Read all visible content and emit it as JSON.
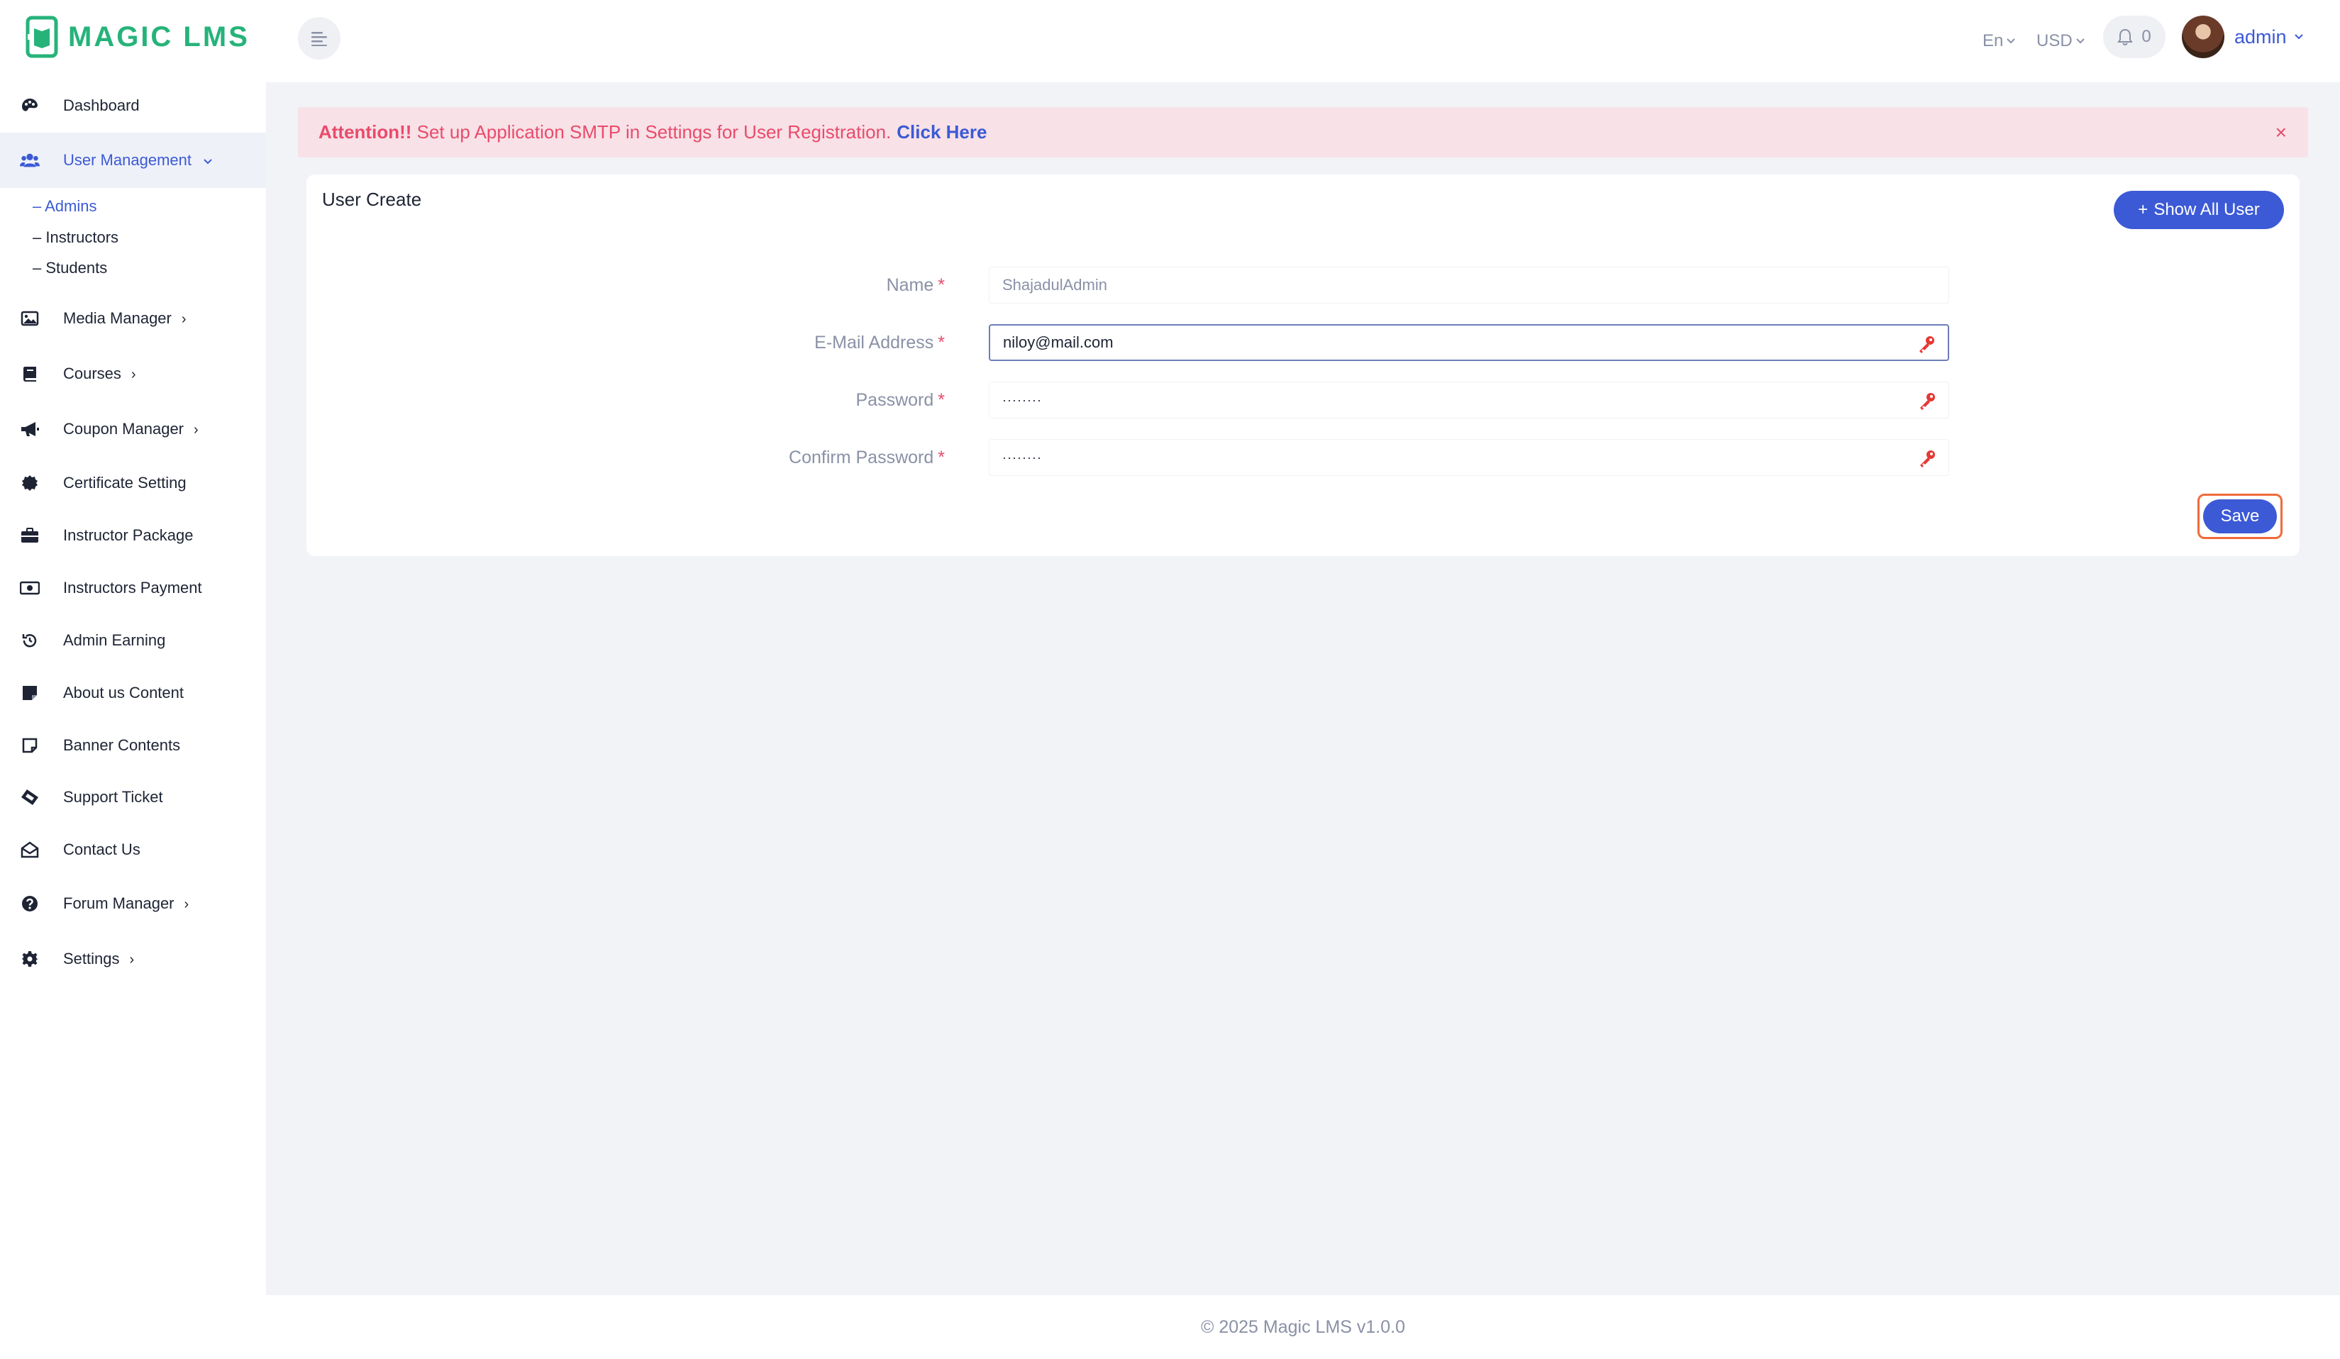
{
  "header": {
    "brand": "MAGIC LMS",
    "language": "En",
    "currency": "USD",
    "notification_count": "0",
    "user_name": "admin",
    "icons": {
      "logo": "book-logo-icon",
      "menu": "align-left-icon",
      "bell": "bell-icon",
      "chevron": "chevron-down-icon"
    }
  },
  "sidebar": {
    "items": [
      {
        "label": "Dashboard",
        "icon": "palette-icon"
      },
      {
        "label": "User Management",
        "icon": "users-icon",
        "arrow": "⌄"
      },
      {
        "label": "Media Manager",
        "icon": "image-icon",
        "arrow": "›"
      },
      {
        "label": "Courses",
        "icon": "book-icon",
        "arrow": "›"
      },
      {
        "label": "Coupon Manager",
        "icon": "megaphone-icon",
        "arrow": "›"
      },
      {
        "label": "Certificate Setting",
        "icon": "certificate-icon"
      },
      {
        "label": "Instructor Package",
        "icon": "briefcase-icon"
      },
      {
        "label": "Instructors Payment",
        "icon": "money-icon"
      },
      {
        "label": "Admin Earning",
        "icon": "history-icon"
      },
      {
        "label": "About us Content",
        "icon": "sticky-note-icon"
      },
      {
        "label": "Banner Contents",
        "icon": "note-icon"
      },
      {
        "label": "Support Ticket",
        "icon": "ticket-icon"
      },
      {
        "label": "Contact Us",
        "icon": "envelope-open-icon"
      },
      {
        "label": "Forum Manager",
        "icon": "question-circle-icon",
        "arrow": "›"
      },
      {
        "label": "Settings",
        "icon": "gear-icon",
        "arrow": "›"
      }
    ],
    "sub_items": [
      "– Admins",
      "– Instructors",
      "– Students"
    ]
  },
  "alert": {
    "prefix": "Attention!!",
    "message": " Set up Application SMTP in Settings for User Registration.",
    "link": "Click Here",
    "close": "×"
  },
  "form": {
    "title": "User Create",
    "show_all_button": "Show All User",
    "plus": "+",
    "required_mark": "*",
    "fields": [
      {
        "label": "Name",
        "value": "ShajadulAdmin"
      },
      {
        "label": "E-Mail Address",
        "value": "niloy@mail.com"
      },
      {
        "label": "Password",
        "value": "········"
      },
      {
        "label": "Confirm Password",
        "value": "········"
      }
    ],
    "save_button": "Save"
  },
  "footer": {
    "text": "© 2025 Magic LMS v1.0.0"
  },
  "colors": {
    "primary": "#3c5ad6",
    "brand": "#26b37a",
    "danger": "#e94b6b",
    "alert_bg": "#f8e1e7",
    "highlight": "#f06a3c"
  }
}
